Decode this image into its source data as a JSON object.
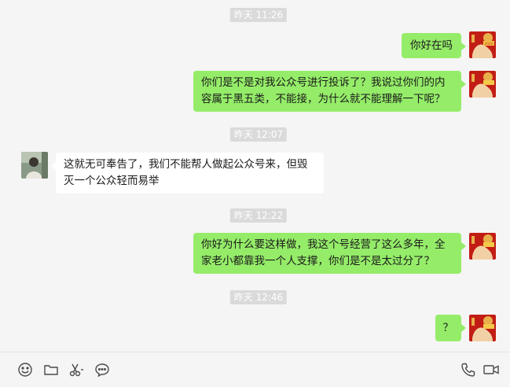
{
  "messages": [
    {
      "type": "time",
      "text": "昨天 11:26"
    },
    {
      "type": "sent",
      "text": "你好在吗"
    },
    {
      "type": "sent",
      "text": "你们是不是对我公众号进行投诉了？我说过你们的内容属于黑五类，不能接，为什么就不能理解一下呢？",
      "lines": [
        "你们是不是对我公众号进行投诉了？我说过你们的内",
        "容属于黑五类，不能接，为什么就不能理解一下呢？"
      ]
    },
    {
      "type": "time",
      "text": "昨天 12:07"
    },
    {
      "type": "received",
      "text": "这就无可奉告了，我们不能帮人做起公众号来，但毁灭一个公众轻而易举",
      "lines": [
        "这就无可奉告了，我们不能帮人做起公众号来，但毁",
        "灭一个公众轻而易举"
      ]
    },
    {
      "type": "time",
      "text": "昨天 12:22"
    },
    {
      "type": "sent",
      "text": "你好为什么要这样做，我这个号经营了这么多年，全家老小都靠我一个人支撑，你们是不是太过分了？",
      "lines": [
        "你好为什么要这样做，我这个号经营了这么多年，全",
        "家老小都靠我一个人支撑，你们是不是太过分了？"
      ]
    },
    {
      "type": "time",
      "text": "昨天 12:46"
    },
    {
      "type": "sent",
      "text": "？"
    }
  ],
  "avatars": {
    "self": "red-new-year-avatar",
    "other": "person-photo-avatar",
    "self_badge_text": "2020"
  },
  "toolbar": {
    "left": [
      "emoji-icon",
      "folder-icon",
      "screenshot-scissors-icon",
      "chat-bubble-icon"
    ],
    "right": [
      "phone-icon",
      "video-call-icon"
    ]
  },
  "colors": {
    "sent_bubble": "#95ec69",
    "received_bubble": "#ffffff",
    "background": "#f5f5f5",
    "timestamp_bg": "#dadada"
  }
}
